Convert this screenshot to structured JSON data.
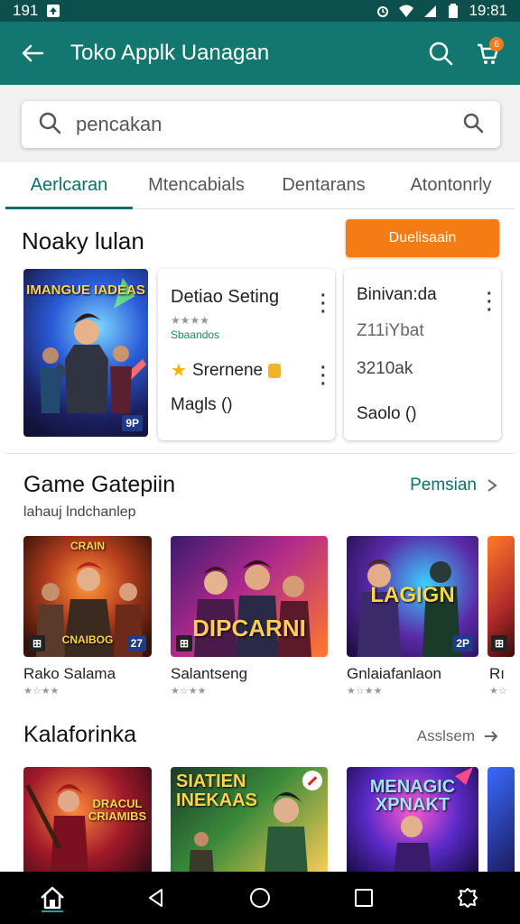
{
  "status_bar": {
    "left_time": "191",
    "right_time": "19:81"
  },
  "app_bar": {
    "title": "Toko Applk Uanagan",
    "cart_badge": "6"
  },
  "search": {
    "placeholder": "pencakan"
  },
  "tabs": [
    {
      "label": "Aerlcaran"
    },
    {
      "label": "Mtencabials"
    },
    {
      "label": "Dentarans"
    },
    {
      "label": "Atontonrly"
    }
  ],
  "featured": {
    "title": "Noaky lulan",
    "action_label": "Duelisaain",
    "poster": {
      "caption": "IMANGUE IADEAS",
      "corner": "9P"
    },
    "card1": {
      "title": "Detiao Seting",
      "rating": "★★★★",
      "subtitle": "Sbaandos",
      "line2": "Srernene",
      "line3": "Magls ()"
    },
    "card2": {
      "line1": "Binivan:da",
      "line2": "Z11iYbat",
      "line3": "3210ak",
      "line4": "Saolo ()"
    }
  },
  "section2": {
    "title": "Game Gatepiin",
    "subtitle": "lahauj lndchanlep",
    "see_all": "Pemsian",
    "games": [
      {
        "name": "Rako Salama",
        "rating": "★☆★★",
        "caption": "CNAIBOG",
        "top_caption": "CRAIN",
        "corner": "27"
      },
      {
        "name": "Salantseng",
        "rating": "★☆★★",
        "caption": "DIPCARNI",
        "top_caption": "",
        "corner": ""
      },
      {
        "name": "Gnlaiafanlaon",
        "rating": "★☆★★",
        "caption": "LAGIGN",
        "top_caption": "",
        "corner": "2P"
      },
      {
        "name": "Rı",
        "rating": "★☆",
        "caption": "",
        "top_caption": "",
        "corner": ""
      }
    ]
  },
  "section3": {
    "title": "Kalaforinka",
    "see_all": "Asslsem",
    "posters": [
      {
        "caption": "DRACUL CRIAMIBS"
      },
      {
        "caption": "SIATIEN INEKAAS"
      },
      {
        "caption": "MENAGIC XPNAKT"
      }
    ]
  },
  "colors": {
    "primary": "#12776f",
    "status_bar": "#0d4f4c",
    "accent": "#f57c14",
    "tab_active": "#0d6f69"
  }
}
